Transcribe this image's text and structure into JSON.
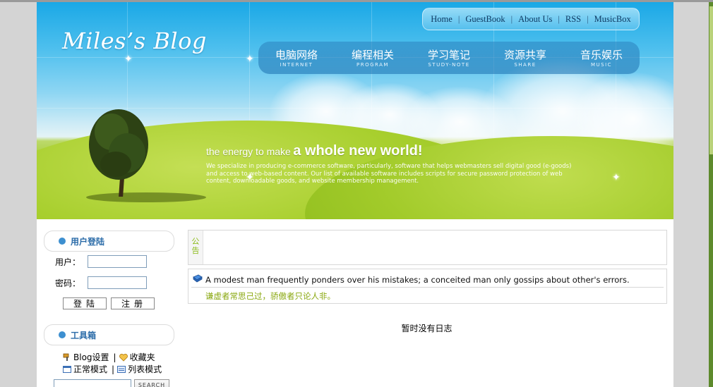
{
  "header": {
    "logo": "Miles’s Blog",
    "top_links": [
      "Home",
      "GuestBook",
      "About Us",
      "RSS",
      "MusicBox"
    ],
    "nav": [
      {
        "cn": "电脑网络",
        "en": "INTERNET"
      },
      {
        "cn": "编程相关",
        "en": "PROGRAM"
      },
      {
        "cn": "学习笔记",
        "en": "STUDY-NOTE"
      },
      {
        "cn": "资源共享",
        "en": "SHARE"
      },
      {
        "cn": "音乐娱乐",
        "en": "MUSIC"
      }
    ],
    "slogan_small": "the energy to make",
    "slogan_big": "a whole new world!",
    "tagline": "We specialize in producing e-commerce software, particularly, software that helps webmasters sell digital good (e-goods) and access to web-based content. Our list of available software includes scripts for secure password protection of web content, downloadable goods, and website membership management."
  },
  "sidebar": {
    "login_title": "用户登陆",
    "user_label": "用户：",
    "password_label": "密码：",
    "login_button": "登陆",
    "register_button": "注册",
    "tools_title": "工具箱",
    "tools": [
      "Blog设置",
      "收藏夹",
      "正常模式",
      "列表模式"
    ],
    "search_button": "SEARCH"
  },
  "main": {
    "notice_tag": "公告",
    "quote_en": "A modest man frequently ponders over his mistakes; a conceited man only gossips about other's errors.",
    "quote_zh": "谦虚者常思己过，骄傲者只论人非。",
    "empty_text": "暂时没有日志"
  },
  "colors": {
    "accent_blue": "#2a6ba8",
    "accent_green": "#8aa810",
    "sky": "#1aa8e6",
    "grass": "#a7cf3b"
  }
}
